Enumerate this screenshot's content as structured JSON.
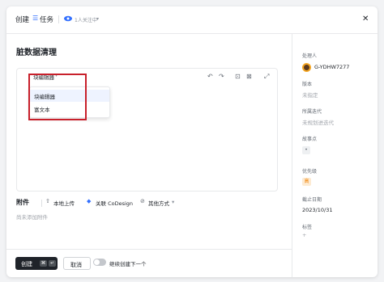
{
  "header": {
    "create_label": "创建",
    "tasks_icon": "list-icon",
    "tasks_label": "任务",
    "followers": "1人关注中",
    "follow_chevron": "▾",
    "close_glyph": "✕"
  },
  "title": "脏数据清理",
  "editor": {
    "mode_label": "块编辑器",
    "mode_chevron": "▾",
    "toolbar_icons": [
      "undo-icon",
      "redo-icon",
      "insert-image-icon",
      "insert-media-icon",
      "expand-icon"
    ],
    "toolbar_glyphs": [
      "↶",
      "↷",
      "⊡",
      "⊠",
      "⤢"
    ],
    "dropdown_options": [
      "块编辑器",
      "富文本"
    ],
    "dropdown_selected": "块编辑器"
  },
  "attachments": {
    "label": "附件",
    "upload_icon": "upload-icon",
    "upload_glyph": "⇧",
    "upload_label": "本地上传",
    "codesign_icon": "codesign-icon",
    "codesign_glyph": "◆",
    "codesign_label": "关联 CoDesign",
    "other_icon": "link-icon",
    "other_glyph": "⊘",
    "other_label": "其他方式",
    "other_chevron": "▾",
    "empty_text": "尚未添加附件"
  },
  "footer": {
    "create_label": "创建",
    "kbd_cmd": "⌘",
    "kbd_enter": "↵",
    "cancel_label": "取消",
    "continue_label": "继续创建下一个",
    "continue_enabled": false
  },
  "sidebar": {
    "assignee_label": "处理人",
    "assignee_value": "G-YDHW7277",
    "version_label": "版本",
    "version_value": "未指定",
    "iteration_label": "所属迭代",
    "iteration_value": "未规划进迭代",
    "story_points_label": "故事点",
    "story_points_value": "•",
    "priority_label": "优先级",
    "priority_value": "高",
    "deadline_label": "截止日期",
    "deadline_value": "2023/10/31",
    "tags_label": "标签",
    "tags_value": "+"
  },
  "colors": {
    "accent": "#3370ff",
    "highlight_border": "#c8202b",
    "priority_high_bg": "#fdebd3",
    "priority_high_text": "#f08000"
  }
}
